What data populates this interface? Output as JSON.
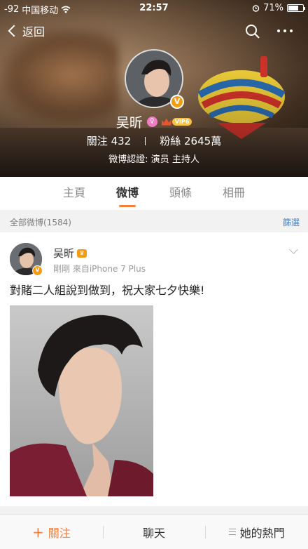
{
  "status_bar": {
    "signal": "-92",
    "carrier": "中国移动",
    "time": "22:57",
    "battery": "71%",
    "battery_level": 0.71
  },
  "nav": {
    "back_label": "返回"
  },
  "profile": {
    "name": "吴昕",
    "vip_label": "VIP6",
    "verified_mark": "V",
    "following_label": "關注",
    "following_count": "432",
    "followers_label": "粉絲",
    "followers_count": "2645萬",
    "verification": "微博認證: 演员 主持人"
  },
  "tabs": [
    {
      "label": "主頁",
      "active": false
    },
    {
      "label": "微博",
      "active": true
    },
    {
      "label": "頭條",
      "active": false
    },
    {
      "label": "相冊",
      "active": false
    }
  ],
  "feed": {
    "count_label": "全部微博(1584)",
    "filter_label": "篩選"
  },
  "post": {
    "author": "吴昕",
    "time": "剛剛",
    "source": "來自iPhone 7 Plus",
    "text": "對賭二人組說到做到，祝大家七夕快樂!"
  },
  "bottom_bar": {
    "follow_label": "關注",
    "chat_label": "聊天",
    "hot_label": "她的熱門"
  },
  "colors": {
    "accent": "#fa7d3c",
    "link": "#507daf",
    "vip_gold": "#f6c144",
    "verified": "#f39c12"
  }
}
